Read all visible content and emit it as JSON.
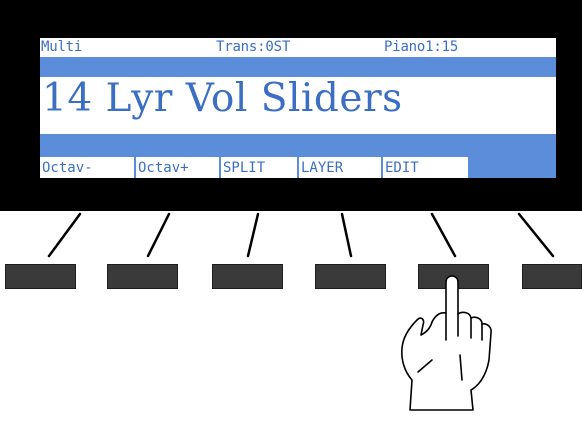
{
  "display": {
    "mode": "Multi",
    "transpose": "Trans:0ST",
    "program_ref": "Piano1:15",
    "program_name": "14 Lyr Vol Sliders",
    "soft_buttons": [
      "Octav-",
      "Octav+",
      "SPLIT",
      "LAYER",
      "EDIT",
      ""
    ]
  },
  "colors": {
    "bezel": "#000000",
    "lcd_text": "#3a6fc4",
    "lcd_bar": "#5b8ddb",
    "button": "#3a3a3a"
  },
  "icons": {
    "pointer": "pointing-hand-icon"
  },
  "pressed_button": "EDIT"
}
